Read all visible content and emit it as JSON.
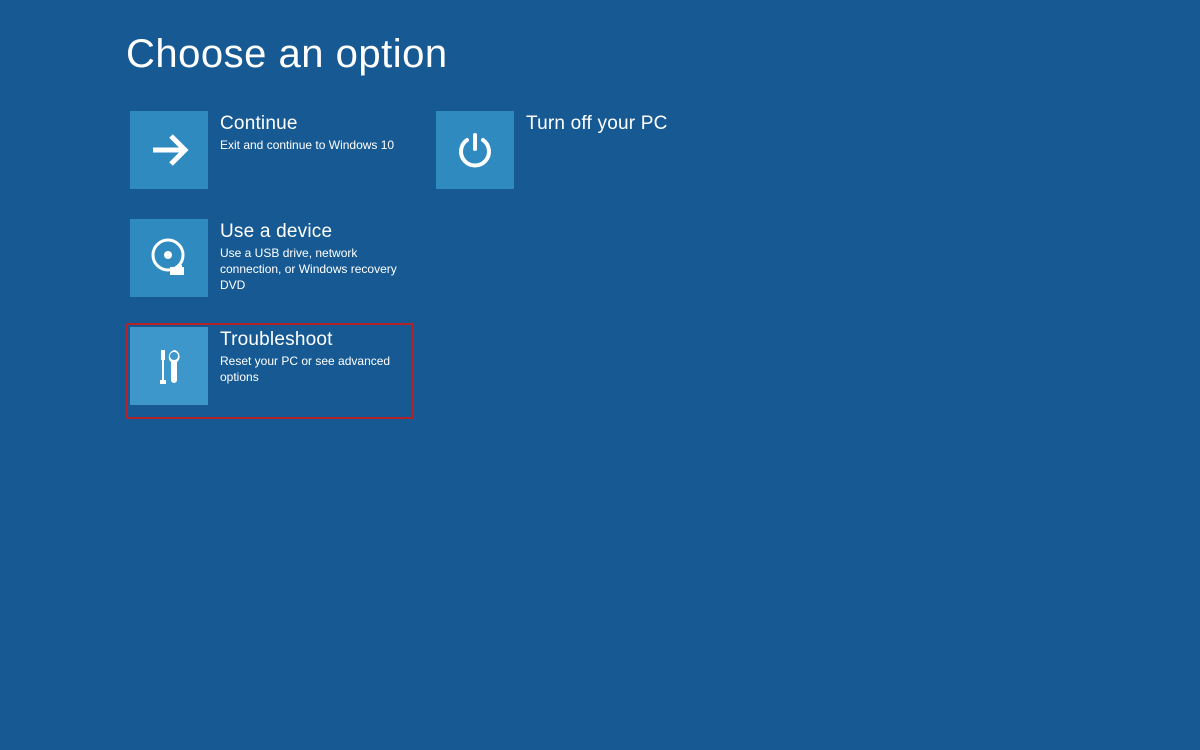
{
  "title": "Choose an option",
  "options": {
    "continue": {
      "title": "Continue",
      "desc": "Exit and continue to Windows 10"
    },
    "device": {
      "title": "Use a device",
      "desc": "Use a USB drive, network connection, or Windows recovery DVD"
    },
    "troubleshoot": {
      "title": "Troubleshoot",
      "desc": "Reset your PC or see advanced options"
    },
    "turnoff": {
      "title": "Turn off your PC",
      "desc": ""
    }
  }
}
